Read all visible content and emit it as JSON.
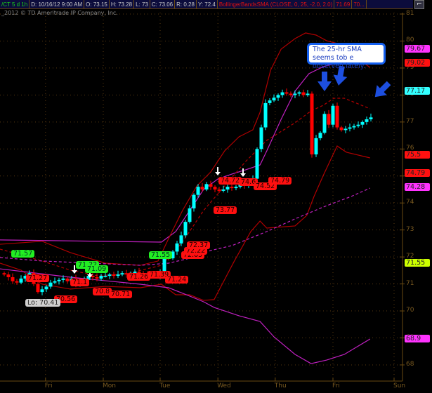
{
  "header": {
    "symbol": "/CT 5 d 1h",
    "date": "D: 10/16/12 9:00 AM",
    "open": "O: 73.15",
    "high": "H: 73.28",
    "low": "L: 73",
    "close": "C: 73.06",
    "range": "R: 0.28",
    "y": "Y: 72.4",
    "study": "BollingerBandsSMA (CLOSE, 0, 25, -2.0, 2.0)",
    "study_v1": "71.69",
    "study_v2": "70...",
    "icon": "chart-style-icon"
  },
  "copyright": "_2012 © TD Ameritrade IP Company, Inc.",
  "annotation": "The 25-hr SMA seems tob e observed lately.",
  "colors": {
    "up": "#00ffff",
    "down": "#ff0000",
    "bb": "#b00000",
    "sma": "#c020c0",
    "grid": "#5a3a10"
  },
  "price_labels": {
    "l1": "71.57",
    "l2": "71.27",
    "l3": "71.22",
    "l4": "71.09",
    "l5": "71.1",
    "l6": "70.8",
    "l7": "70.71",
    "l8": "70.56",
    "lo": "Lo: 70.41",
    "l9": "71.26",
    "l10": "71.39",
    "l11": "71.24",
    "l12": "71.55",
    "l13": "72.37",
    "l14": "72.22",
    "l15": "72.05",
    "l16": "73.77",
    "l17": "74.72",
    "l18": "74.6",
    "l19": "74.52",
    "l20": "74.79"
  },
  "axis_tags": {
    "t1": "79.67",
    "t2": "79.02",
    "t3": "77.17",
    "t4": "75.5",
    "t5": "74.79",
    "t6": "74.28",
    "t7": "71.55",
    "t8": "68.9"
  },
  "chart_data": {
    "type": "candlestick",
    "title": "/CT 5 d 1h",
    "ylim": [
      68,
      81
    ],
    "yticks": [
      "68",
      "69",
      "70",
      "71",
      "72",
      "73",
      "74",
      "75",
      "76",
      "77",
      "78",
      "79",
      "80",
      "81"
    ],
    "xticks": [
      "Fri",
      "Mon",
      "Tue",
      "Wed",
      "Thu",
      "Fri",
      "Sun"
    ],
    "xtick_bars": [
      9.8,
      23.5,
      37,
      50.7,
      64.3,
      78,
      92.5
    ],
    "closes": [
      71.35,
      71.25,
      71.1,
      71.05,
      71.2,
      71.3,
      71.4,
      71.0,
      70.7,
      70.8,
      70.9,
      71.05,
      71.1,
      71.15,
      71.2,
      71.1,
      71.2,
      71.0,
      71.05,
      71.15,
      71.3,
      71.25,
      71.2,
      71.3,
      71.3,
      71.35,
      71.3,
      71.35,
      71.4,
      71.35,
      71.4,
      71.45,
      71.4,
      71.35,
      71.3,
      71.35,
      71.3,
      71.4,
      72.0,
      71.95,
      72.2,
      72.5,
      72.8,
      73.3,
      73.8,
      74.3,
      74.6,
      74.5,
      74.7,
      74.6,
      74.5,
      74.45,
      74.5,
      74.6,
      74.55,
      74.6,
      74.7,
      74.65,
      74.8,
      74.9,
      76.0,
      76.8,
      77.7,
      77.8,
      77.9,
      78.0,
      78.1,
      78.05,
      78.0,
      78.05,
      78.1,
      78.0,
      78.05,
      75.8,
      76.4,
      76.6,
      77.3,
      76.9,
      77.6,
      76.8,
      76.7,
      76.75,
      76.8,
      76.85,
      76.9,
      77.0,
      77.1,
      77.17
    ],
    "lines": [
      {
        "name": "sma-upper-purple",
        "color": "#c020c0",
        "dash": false,
        "points": [
          [
            -1,
            72.63
          ],
          [
            37.3,
            72.55
          ],
          [
            40.7,
            72.94
          ],
          [
            44,
            73.72
          ],
          [
            47.3,
            74.5
          ],
          [
            50.7,
            74.89
          ],
          [
            54,
            75.07
          ],
          [
            57.3,
            75.23
          ],
          [
            60.7,
            75.41
          ],
          [
            62.3,
            75.93
          ],
          [
            65.7,
            77.1
          ],
          [
            69,
            78.14
          ],
          [
            72.3,
            78.79
          ],
          [
            75.7,
            79.05
          ],
          [
            78.7,
            79.18
          ],
          [
            86.8,
            79.67
          ]
        ]
      },
      {
        "name": "bollinger-upper",
        "color": "#b00000",
        "dash": false,
        "points": [
          [
            -1,
            72.47
          ],
          [
            9,
            72.58
          ],
          [
            15.7,
            72.16
          ],
          [
            24,
            71.77
          ],
          [
            32.3,
            71.69
          ],
          [
            36.5,
            71.85
          ],
          [
            39,
            72.68
          ],
          [
            42.3,
            73.72
          ],
          [
            45.7,
            74.63
          ],
          [
            49,
            75.15
          ],
          [
            52.3,
            75.93
          ],
          [
            55.7,
            76.45
          ],
          [
            59,
            76.71
          ],
          [
            60.7,
            77.36
          ],
          [
            63.2,
            78.92
          ],
          [
            65.7,
            79.7
          ],
          [
            69,
            80.09
          ],
          [
            71.5,
            80.3
          ],
          [
            74,
            80.22
          ],
          [
            76.5,
            80.01
          ],
          [
            79,
            79.91
          ],
          [
            86.8,
            79.02
          ]
        ]
      },
      {
        "name": "bollinger-lower",
        "color": "#b00000",
        "dash": false,
        "points": [
          [
            -1,
            71.77
          ],
          [
            4,
            71.51
          ],
          [
            9,
            70.99
          ],
          [
            15.7,
            70.81
          ],
          [
            24,
            70.91
          ],
          [
            32.3,
            70.86
          ],
          [
            37.3,
            70.99
          ],
          [
            40.7,
            70.6
          ],
          [
            44,
            70.6
          ],
          [
            47.3,
            70.39
          ],
          [
            49.8,
            70.42
          ],
          [
            54.5,
            71.82
          ],
          [
            58.5,
            72.94
          ],
          [
            60.7,
            73.33
          ],
          [
            62.3,
            73.07
          ],
          [
            69,
            73.15
          ],
          [
            71.8,
            73.54
          ],
          [
            73.5,
            74.24
          ],
          [
            75.7,
            75.02
          ],
          [
            77.8,
            75.72
          ],
          [
            79,
            76.11
          ],
          [
            81.2,
            75.88
          ],
          [
            86.8,
            75.67
          ]
        ]
      },
      {
        "name": "sma-lower-purple",
        "color": "#c020c0",
        "dash": false,
        "points": [
          [
            -1,
            71.56
          ],
          [
            15.7,
            71.25
          ],
          [
            32.3,
            70.99
          ],
          [
            39,
            70.86
          ],
          [
            43.2,
            70.6
          ],
          [
            47.3,
            70.34
          ],
          [
            49.8,
            70.13
          ],
          [
            55.7,
            69.82
          ],
          [
            60.7,
            69.61
          ],
          [
            64,
            69.04
          ],
          [
            69,
            68.39
          ],
          [
            72.8,
            68.05
          ],
          [
            76.5,
            68.18
          ],
          [
            80.7,
            68.39
          ],
          [
            86.8,
            68.96
          ]
        ]
      },
      {
        "name": "sma-25-dashed-red",
        "color": "#b00000",
        "dash": true,
        "points": [
          [
            -1,
            72.29
          ],
          [
            9,
            71.85
          ],
          [
            15.7,
            71.51
          ],
          [
            22.3,
            71.3
          ],
          [
            29,
            71.38
          ],
          [
            37.3,
            71.69
          ],
          [
            42.3,
            72.55
          ],
          [
            47.3,
            73.72
          ],
          [
            52.3,
            74.63
          ],
          [
            57.3,
            75.54
          ],
          [
            62.3,
            76.32
          ],
          [
            69,
            76.97
          ],
          [
            72.8,
            77.41
          ],
          [
            75.7,
            77.62
          ],
          [
            78.2,
            77.88
          ],
          [
            80.7,
            77.88
          ],
          [
            84,
            77.67
          ],
          [
            86.8,
            77.49
          ]
        ]
      },
      {
        "name": "sma-dashed-purple",
        "color": "#c020c0",
        "dash": true,
        "points": [
          [
            -1,
            71.98
          ],
          [
            9,
            71.85
          ],
          [
            20.7,
            71.77
          ],
          [
            32.3,
            71.69
          ],
          [
            39,
            71.77
          ],
          [
            44,
            71.95
          ],
          [
            49,
            72.24
          ],
          [
            54,
            72.42
          ],
          [
            62.3,
            72.94
          ],
          [
            69,
            73.41
          ],
          [
            75.7,
            73.85
          ],
          [
            82.3,
            74.24
          ],
          [
            86.8,
            74.55
          ]
        ]
      }
    ]
  }
}
